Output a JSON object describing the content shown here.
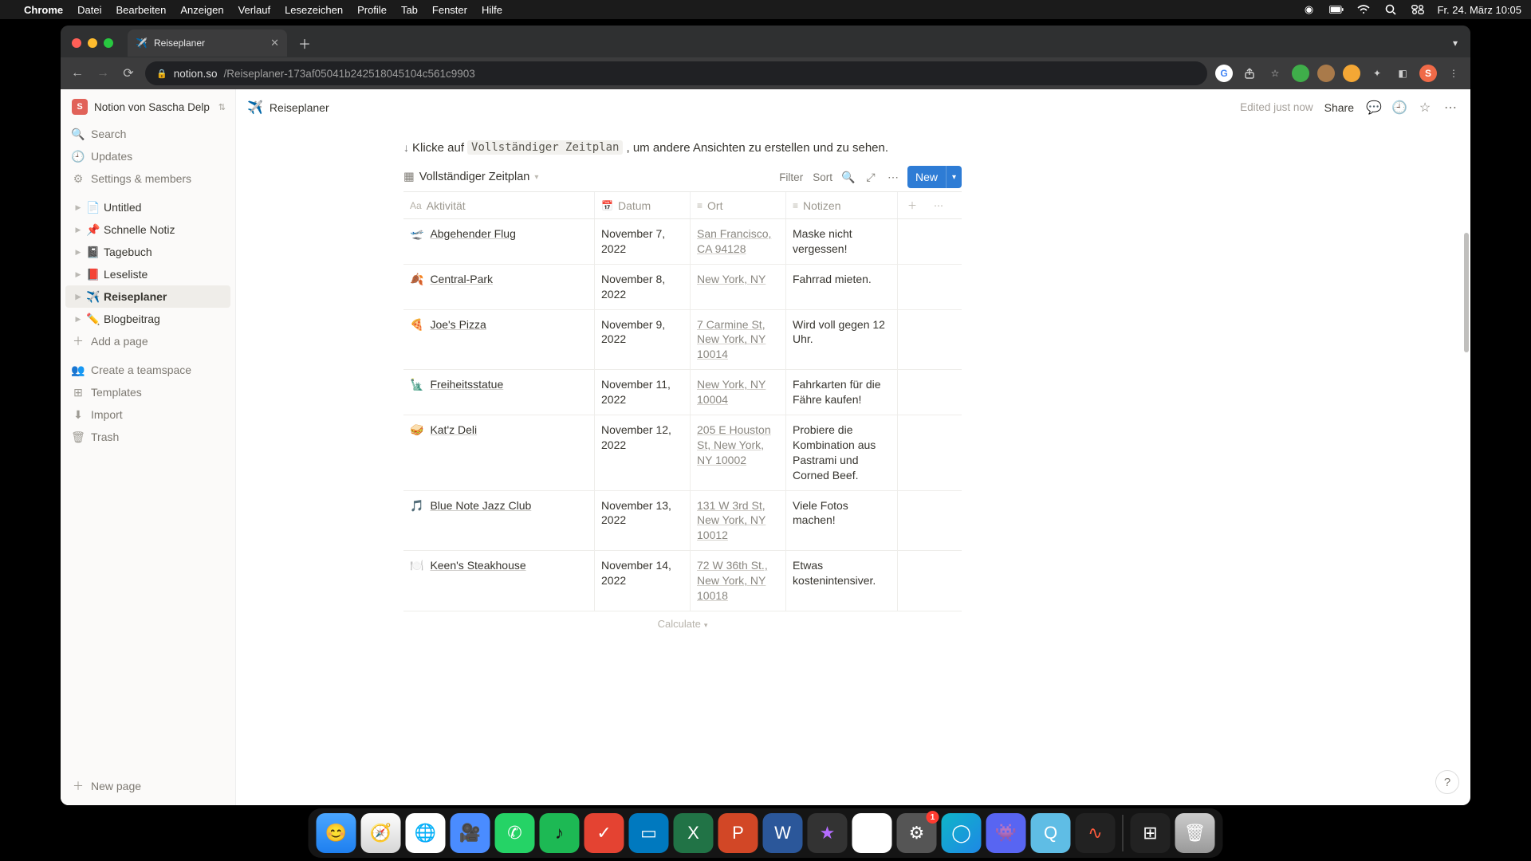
{
  "mac": {
    "app": "Chrome",
    "menus": [
      "Datei",
      "Bearbeiten",
      "Anzeigen",
      "Verlauf",
      "Lesezeichen",
      "Profile",
      "Tab",
      "Fenster",
      "Hilfe"
    ],
    "clock": "Fr. 24. März  10:05"
  },
  "chrome": {
    "tab_title": "Reiseplaner",
    "url_host": "notion.so",
    "url_path": "/Reiseplaner-173af05041b242518045104c561c9903",
    "avatar_letter": "S"
  },
  "notion": {
    "workspace": "Notion von Sascha Delp",
    "workspace_initial": "S",
    "nav": {
      "search": "Search",
      "updates": "Updates",
      "settings": "Settings & members"
    },
    "pages": [
      {
        "emoji": "📄",
        "label": "Untitled"
      },
      {
        "emoji": "📌",
        "label": "Schnelle Notiz"
      },
      {
        "emoji": "📓",
        "label": "Tagebuch"
      },
      {
        "emoji": "📕",
        "label": "Leseliste"
      },
      {
        "emoji": "✈️",
        "label": "Reiseplaner",
        "active": true
      },
      {
        "emoji": "✏️",
        "label": "Blogbeitrag"
      }
    ],
    "add_page": "Add a page",
    "bottom": {
      "teamspace": "Create a teamspace",
      "templates": "Templates",
      "import": "Import",
      "trash": "Trash",
      "new_page": "New page"
    },
    "topbar": {
      "breadcrumb_emoji": "✈️",
      "breadcrumb": "Reiseplaner",
      "edited": "Edited just now",
      "share": "Share"
    },
    "helper": {
      "arrow": "↓",
      "pre": "Klicke auf",
      "code": "Vollständiger Zeitplan",
      "post": ", um andere Ansichten zu erstellen und zu sehen."
    },
    "view": {
      "name": "Vollständiger Zeitplan",
      "filter": "Filter",
      "sort": "Sort",
      "new": "New"
    },
    "columns": {
      "activity": "Aktivität",
      "date": "Datum",
      "location": "Ort",
      "notes": "Notizen"
    },
    "rows": [
      {
        "emoji": "🛫",
        "activity": "Abgehender Flug",
        "date": "November 7, 2022",
        "location": "San Francisco, CA 94128",
        "notes": "Maske nicht vergessen!"
      },
      {
        "emoji": "🍂",
        "activity": "Central-Park",
        "date": "November 8, 2022",
        "location": "New York, NY",
        "notes": "Fahrrad mieten."
      },
      {
        "emoji": "🍕",
        "activity": "Joe's Pizza",
        "date": "November 9, 2022",
        "location": "7 Carmine St, New York, NY 10014",
        "notes": "Wird voll gegen 12 Uhr."
      },
      {
        "emoji": "🗽",
        "activity": "Freiheitsstatue",
        "date": "November 11, 2022",
        "location": "New York, NY 10004",
        "notes": "Fahrkarten für die Fähre kaufen!"
      },
      {
        "emoji": "🥪",
        "activity": "Kat'z Deli",
        "date": "November 12, 2022",
        "location": "205 E Houston St, New York, NY 10002",
        "notes": "Probiere die Kombination aus Pastrami und Corned Beef."
      },
      {
        "emoji": "🎵",
        "activity": "Blue Note Jazz Club",
        "date": "November 13, 2022",
        "location": "131 W 3rd St, New York, NY 10012",
        "notes": "Viele Fotos machen!"
      },
      {
        "emoji": "🍽️",
        "activity": "Keen's Steakhouse",
        "date": "November 14, 2022",
        "location": "72 W 36th St., New York, NY 10018",
        "notes": "Etwas kostenintensiver."
      }
    ],
    "calculate": "Calculate"
  },
  "dock_badge": "1"
}
